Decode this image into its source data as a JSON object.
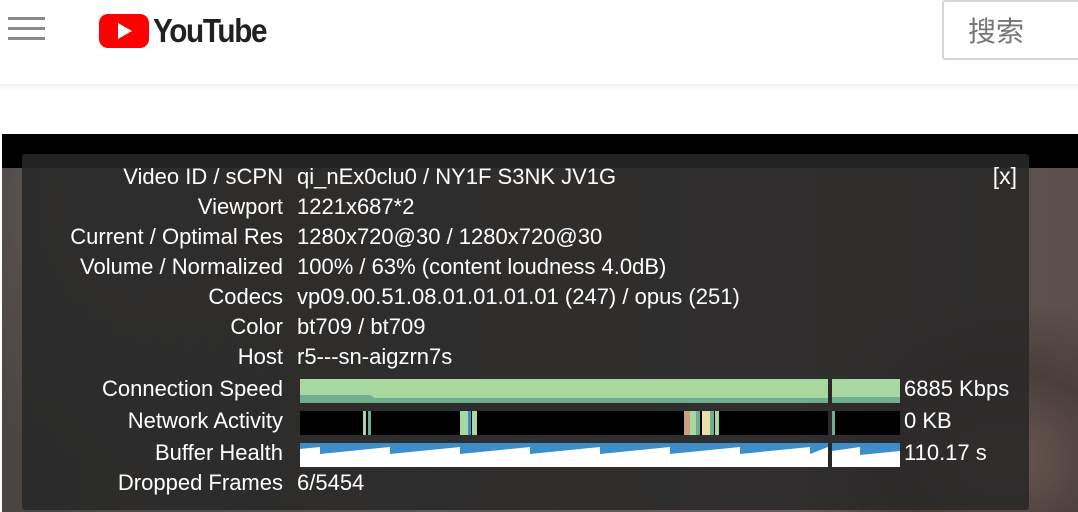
{
  "header": {
    "logo_text": "YouTube",
    "logo_color": "#ff0000",
    "menu_icon": "hamburger-menu-icon",
    "search_placeholder": "搜索"
  },
  "stats": {
    "close_label": "[x]",
    "rows": [
      {
        "label": "Video ID / sCPN",
        "value": "qi_nEx0clu0 / NY1F S3NK JV1G"
      },
      {
        "label": "Viewport",
        "value": "1221x687*2"
      },
      {
        "label": "Current / Optimal Res",
        "value": "1280x720@30 / 1280x720@30"
      },
      {
        "label": "Volume / Normalized",
        "value": "100% / 63% (content loudness 4.0dB)"
      },
      {
        "label": "Codecs",
        "value": "vp09.00.51.08.01.01.01.01 (247) / opus (251)"
      },
      {
        "label": "Color",
        "value": "bt709 / bt709"
      },
      {
        "label": "Host",
        "value": "r5---sn-aigzrn7s"
      }
    ],
    "connection_speed": {
      "label": "Connection Speed",
      "value": "6885 Kbps",
      "color": "#a8d8a0"
    },
    "network_activity": {
      "label": "Network Activity",
      "value": "0 KB"
    },
    "buffer_health": {
      "label": "Buffer Health",
      "value": "110.17 s",
      "color": "#3b8ec9"
    },
    "dropped_frames": {
      "label": "Dropped Frames",
      "value": "6/5454"
    }
  }
}
